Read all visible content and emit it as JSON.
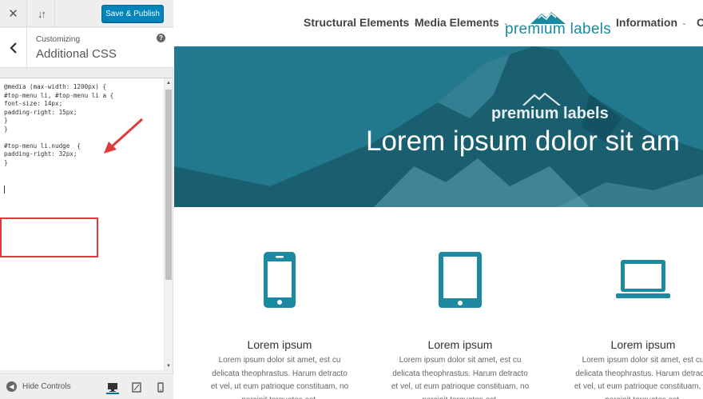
{
  "customizer": {
    "publish_label": "Save & Publish",
    "breadcrumb": "Customizing",
    "section_title": "Additional CSS",
    "help_glyph": "?",
    "css_code": "@media (max-width: 1200px) {\n#top-menu li, #top-menu li a {\nfont-size: 14px;\npadding-right: 15px;\n}\n}\n\n#top-menu li.nudge  {\npadding-right: 32px;\n}",
    "hide_controls_label": "Hide Controls"
  },
  "site": {
    "nav": [
      {
        "label": "Structural Elements"
      },
      {
        "label": "Media Elements"
      },
      {
        "label": "Information"
      },
      {
        "label": "C"
      }
    ],
    "logo_text": "premium labels",
    "hero_logo_text": "premium labels",
    "hero_title": "Lorem ipsum dolor sit am",
    "features": [
      {
        "icon": "smartphone-icon",
        "title": "Lorem ipsum",
        "text": "Lorem ipsum dolor sit amet, est cu delicata theophrastus. Harum detracto et vel, ut eum patrioque constituam, no percipit torquatos est."
      },
      {
        "icon": "tablet-icon",
        "title": "Lorem ipsum",
        "text": "Lorem ipsum dolor sit amet, est cu delicata theophrastus. Harum detracto et vel, ut eum patrioque constituam, no percipit torquatos est."
      },
      {
        "icon": "laptop-icon",
        "title": "Lorem ipsum",
        "text": "Lorem ipsum dolor sit amet, est cu delicata theophrastus. Harum detracto et vel, ut eum patrioque constituam, no percipit torquatos est."
      }
    ]
  },
  "colors": {
    "accent": "#0085ba",
    "brand_teal": "#1b8aa0",
    "hero_overlay": "#1d6f82",
    "annotation_red": "#e03a3a"
  }
}
